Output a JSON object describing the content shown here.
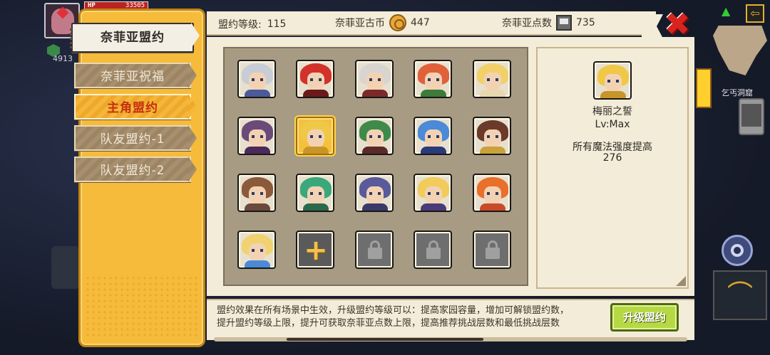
{
  "hud": {
    "hp_label": "HP",
    "hp_value": "33505",
    "player_level": "4913",
    "location_label": "乞丐洞窟",
    "icons": [
      "player-portrait",
      "wifi-icon",
      "exit-icon",
      "minimap",
      "phone-icon",
      "gear-icon",
      "bow-icon"
    ]
  },
  "tabs": [
    {
      "label": "奈菲亚盟约",
      "state": "active"
    },
    {
      "label": "奈菲亚祝福",
      "state": "normal"
    },
    {
      "label": "主角盟约",
      "state": "highlight"
    },
    {
      "label": "队友盟约-1",
      "state": "normal"
    },
    {
      "label": "队友盟约-2",
      "state": "normal"
    }
  ],
  "topbar": {
    "level_label": "盟约等级:",
    "level_value": "115",
    "coin_label": "奈菲亚古币",
    "coin_value": "447",
    "points_label": "奈菲亚点数",
    "points_value": "735"
  },
  "close_icon": "close-x",
  "slots": [
    {
      "hair": "#c8ccd6",
      "body": "#4a5a9a",
      "state": "hero"
    },
    {
      "hair": "#d2322a",
      "body": "#6a1a1a",
      "state": "hero"
    },
    {
      "hair": "#d8d4d0",
      "body": "#7a2a2a",
      "state": "hero"
    },
    {
      "hair": "#e0603a",
      "body": "#3e7a3a",
      "state": "hero"
    },
    {
      "hair": "#f1d06a",
      "body": "#e8d8b0",
      "state": "hero"
    },
    {
      "hair": "#6a4a78",
      "body": "#4a2a5a",
      "state": "hero"
    },
    {
      "hair": "#f0c848",
      "body": "#c89628",
      "state": "selected"
    },
    {
      "hair": "#3e8a4a",
      "body": "#5a2a2a",
      "state": "hero"
    },
    {
      "hair": "#4a8ad8",
      "body": "#2a3a7a",
      "state": "hero"
    },
    {
      "hair": "#6a3a2a",
      "body": "#c8a23a",
      "state": "hero"
    },
    {
      "hair": "#8a5a3a",
      "body": "#6a4a3a",
      "state": "hero"
    },
    {
      "hair": "#3aa87a",
      "body": "#2a6a4a",
      "state": "hero"
    },
    {
      "hair": "#5a5a9a",
      "body": "#3a3a6a",
      "state": "hero"
    },
    {
      "hair": "#f2cc5a",
      "body": "#4a3a7a",
      "state": "hero"
    },
    {
      "hair": "#e8702a",
      "body": "#c84a2a",
      "state": "hero"
    },
    {
      "hair": "#f0d270",
      "body": "#4a8ad8",
      "state": "hero"
    },
    {
      "state": "add"
    },
    {
      "state": "locked"
    },
    {
      "state": "locked"
    },
    {
      "state": "locked"
    }
  ],
  "detail": {
    "name": "梅丽之誓",
    "level": "Lv:Max",
    "effect": "所有魔法强度提高",
    "value": "276"
  },
  "bottom": {
    "line1": "盟约效果在所有场景中生效，升级盟约等级可以：提高家园容量，增加可解锁盟约数，",
    "line2": "提升盟约等级上限，提升可获取奈菲亚点数上限，提高推荐挑战层数和最低挑战层数",
    "upgrade_label": "升级盟约"
  },
  "colors": {
    "tab_panel": "#f6bb3a",
    "upgrade_button": "#b6d844",
    "close": "#d8231e"
  }
}
